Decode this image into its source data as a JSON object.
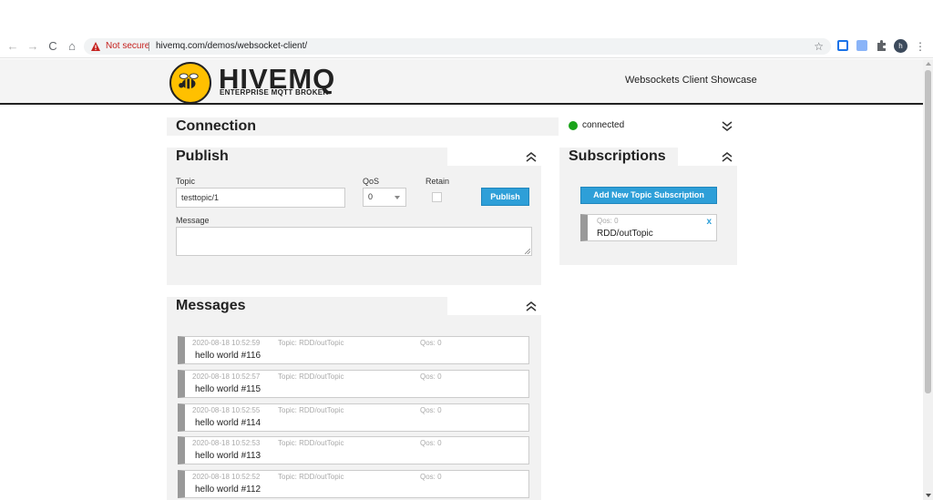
{
  "browser": {
    "nav_back": "←",
    "nav_forward": "→",
    "nav_reload": "C",
    "nav_home": "⌂",
    "security_label": "Not secure",
    "url": "hivemq.com/demos/websocket-client/",
    "bookmark_glyph": "☆",
    "profile_initial": "h",
    "menu_glyph": "⋮",
    "colors": {
      "warning": "#c5221f"
    }
  },
  "header": {
    "brand": "HIVEMQ",
    "tagline": "ENTERPRISE MQTT BROKER",
    "showcase_title": "Websockets Client Showcase",
    "colors": {
      "logo": "#ffc000"
    }
  },
  "connection": {
    "title": "Connection",
    "status": "connected",
    "status_color": "#1aa31a"
  },
  "publish": {
    "title": "Publish",
    "topic_label": "Topic",
    "topic_value": "testtopic/1",
    "qos_label": "QoS",
    "qos_value": "0",
    "retain_label": "Retain",
    "publish_label": "Publish",
    "message_label": "Message"
  },
  "subscriptions": {
    "title": "Subscriptions",
    "add_label": "Add New Topic Subscription",
    "items": [
      {
        "qos": "Qos: 0",
        "topic": "RDD/outTopic",
        "close": "x"
      }
    ]
  },
  "messages": {
    "title": "Messages",
    "items": [
      {
        "date": "2020-08-18 10:52:59",
        "topic": "Topic: RDD/outTopic",
        "qos": "Qos: 0",
        "payload": "hello world #116"
      },
      {
        "date": "2020-08-18 10:52:57",
        "topic": "Topic: RDD/outTopic",
        "qos": "Qos: 0",
        "payload": "hello world #115"
      },
      {
        "date": "2020-08-18 10:52:55",
        "topic": "Topic: RDD/outTopic",
        "qos": "Qos: 0",
        "payload": "hello world #114"
      },
      {
        "date": "2020-08-18 10:52:53",
        "topic": "Topic: RDD/outTopic",
        "qos": "Qos: 0",
        "payload": "hello world #113"
      },
      {
        "date": "2020-08-18 10:52:52",
        "topic": "Topic: RDD/outTopic",
        "qos": "Qos: 0",
        "payload": "hello world #112"
      }
    ]
  },
  "accent_color": "#2e9fd8"
}
